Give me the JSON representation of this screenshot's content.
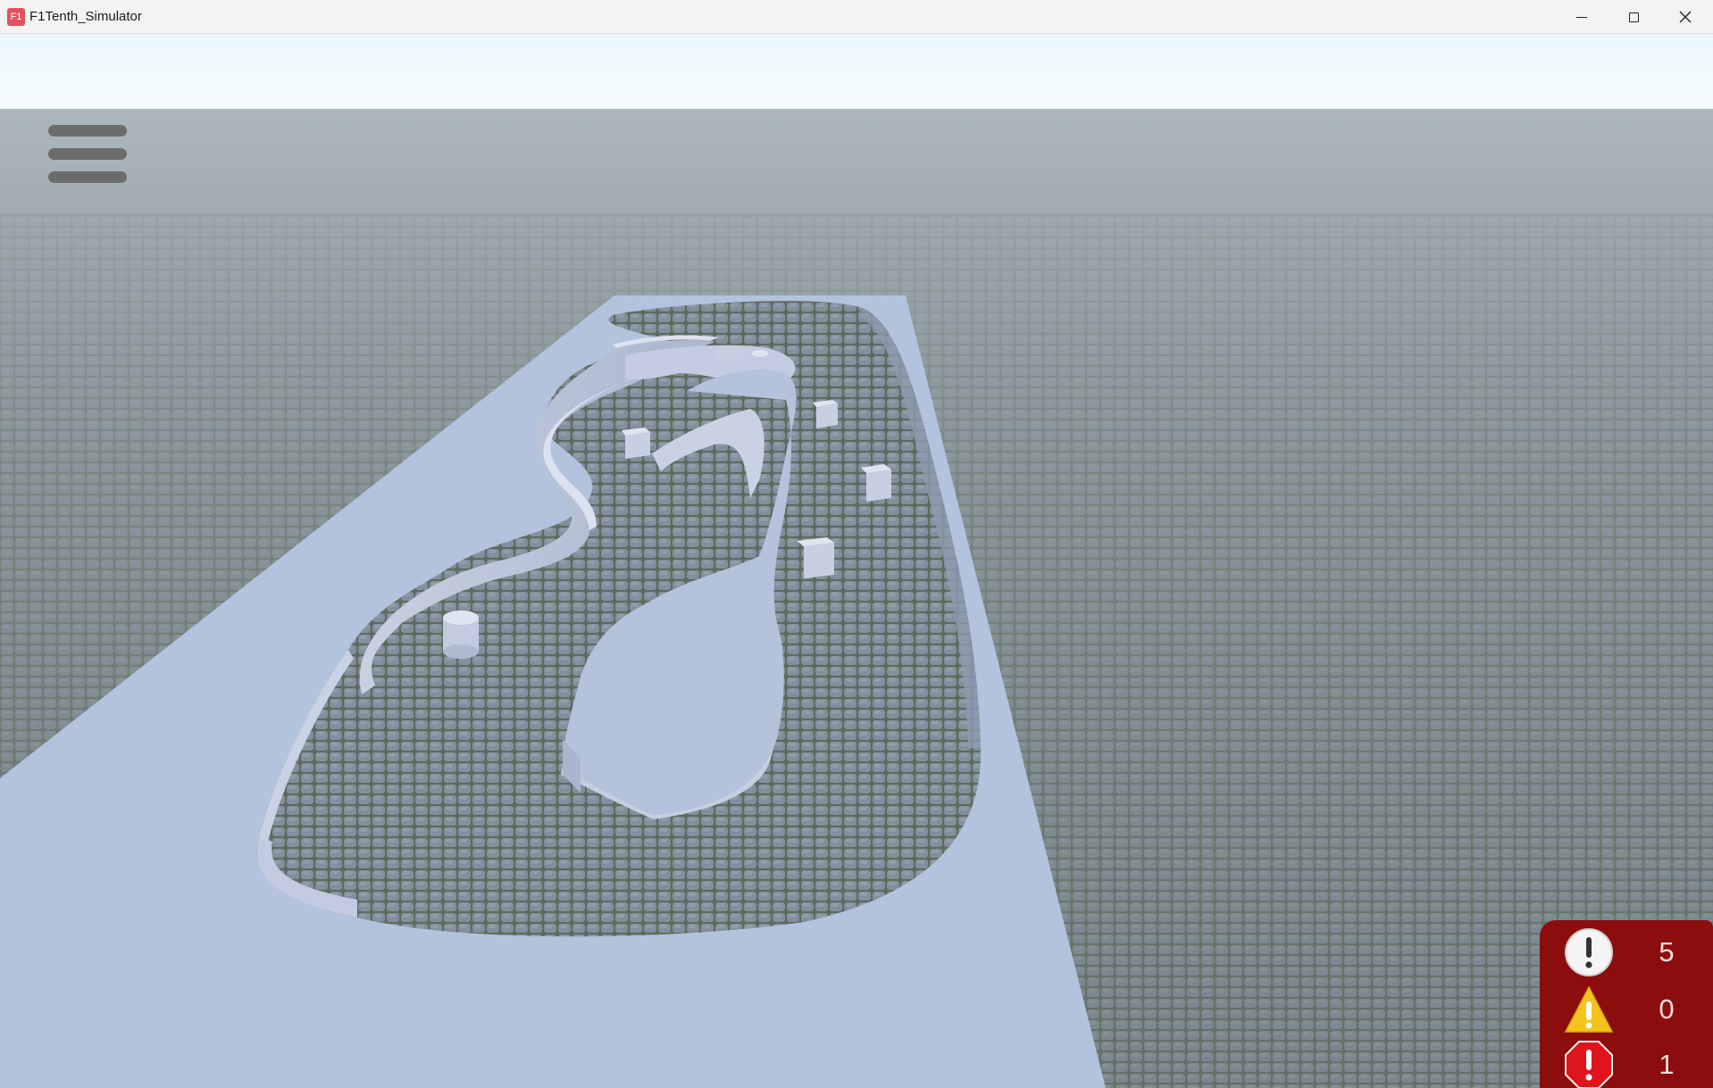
{
  "window": {
    "title": "F1Tenth_Simulator",
    "app_icon_text": "F1",
    "controls": {
      "minimize": "minimize-icon",
      "maximize": "maximize-icon",
      "close": "close-icon"
    }
  },
  "scene": {
    "description_icons": [
      "hamburger-menu-icon"
    ],
    "colors": {
      "sky_top": "#eef8fb",
      "sky_horizon": "#b9c9cf",
      "ground": "#6f7a77",
      "track_surface": "#b3c2dd",
      "wall": "#c6cfe2",
      "status_panel": "#8c0d0e"
    }
  },
  "menu": {
    "icon": "hamburger-menu-icon"
  },
  "status": {
    "info": {
      "icon": "info-exclamation-icon",
      "count": "5"
    },
    "warning": {
      "icon": "warning-triangle-icon",
      "count": "0"
    },
    "error": {
      "icon": "error-octagon-icon",
      "count": "1"
    }
  }
}
